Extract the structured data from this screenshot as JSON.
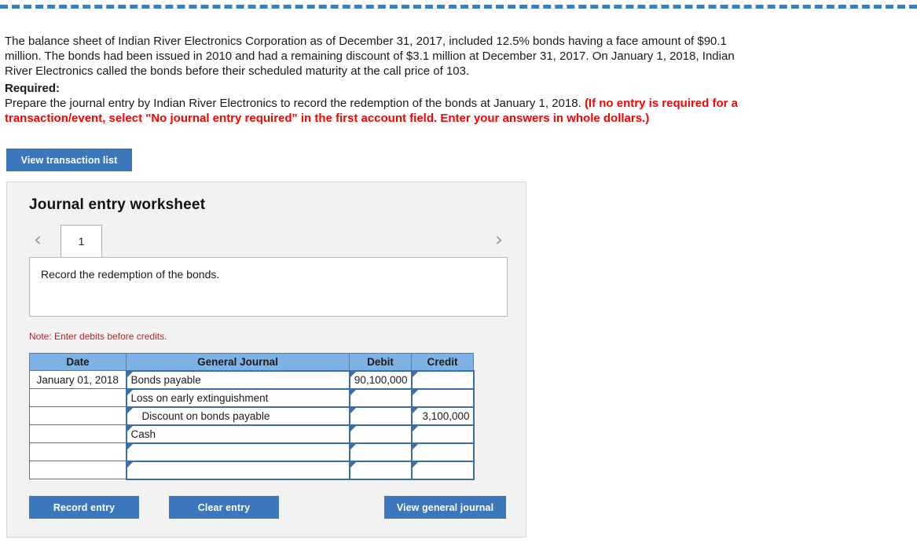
{
  "problem": {
    "text": "The balance sheet of Indian River Electronics Corporation as of December 31, 2017, included 12.5% bonds having a face amount of $90.1 million. The bonds had been issued in 2010 and had a remaining discount of $3.1 million at December 31, 2017. On January 1, 2018, Indian River Electronics called the bonds before their scheduled maturity at the call price of 103."
  },
  "required": {
    "label": "Required:",
    "instruction": "Prepare the journal entry by Indian River Electronics to record the redemption of the bonds at January 1, 2018.",
    "emphasis": "(If no entry is required for a transaction/event, select \"No journal entry required\" in the first account field. Enter your answers in whole dollars.)"
  },
  "toolbar": {
    "view_transaction_list": "View transaction list"
  },
  "worksheet": {
    "title": "Journal entry worksheet",
    "prev_icon": "chevron-left-icon",
    "next_icon": "chevron-right-icon",
    "tabs": [
      {
        "label": "1",
        "active": true
      }
    ],
    "instruction": "Record the redemption of the bonds.",
    "note": "Note: Enter debits before credits."
  },
  "journal": {
    "headers": {
      "date": "Date",
      "general_journal": "General Journal",
      "debit": "Debit",
      "credit": "Credit"
    },
    "rows": [
      {
        "date": "January 01, 2018",
        "account": "Bonds payable",
        "indent": false,
        "debit": "90,100,000",
        "credit": ""
      },
      {
        "date": "",
        "account": "Loss on early extinguishment",
        "indent": false,
        "debit": "",
        "credit": ""
      },
      {
        "date": "",
        "account": "Discount on bonds payable",
        "indent": true,
        "debit": "",
        "credit": "3,100,000"
      },
      {
        "date": "",
        "account": "Cash",
        "indent": false,
        "debit": "",
        "credit": ""
      },
      {
        "date": "",
        "account": "",
        "indent": false,
        "debit": "",
        "credit": ""
      },
      {
        "date": "",
        "account": "",
        "indent": false,
        "debit": "",
        "credit": ""
      }
    ]
  },
  "footer": {
    "record_entry": "Record entry",
    "clear_entry": "Clear entry",
    "view_general_journal": "View general journal"
  },
  "colors": {
    "accent_blue": "#3c77bc",
    "header_blue": "#7eb2e6",
    "input_border_blue": "#3d6fa5",
    "note_red": "#b02a2a",
    "emphasis_red": "#ff0000",
    "panel_gray": "#f2f2f2"
  }
}
